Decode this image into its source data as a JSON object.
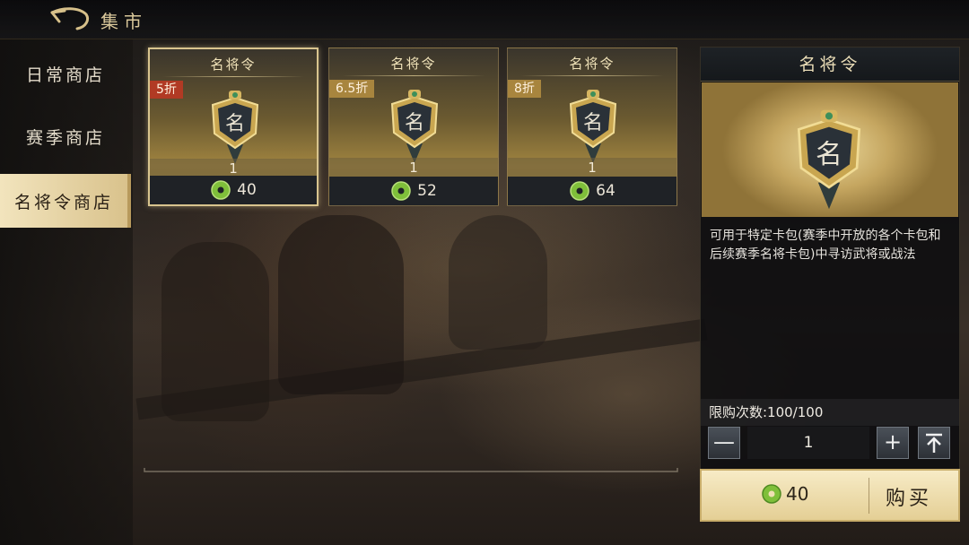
{
  "header": {
    "title": "集市"
  },
  "sidebar": {
    "items": [
      {
        "label": "日常商店"
      },
      {
        "label": "赛季商店"
      },
      {
        "label": "名将令商店",
        "active": true
      }
    ]
  },
  "shop_items": [
    {
      "name": "名将令",
      "discount": "5折",
      "quantity": "1",
      "price": "40",
      "selected": true
    },
    {
      "name": "名将令",
      "discount": "6.5折",
      "quantity": "1",
      "price": "52"
    },
    {
      "name": "名将令",
      "discount": "8折",
      "quantity": "1",
      "price": "64"
    }
  ],
  "detail": {
    "title": "名将令",
    "description": "可用于特定卡包(赛季中开放的各个卡包和后续赛季名将卡包)中寻访武将或战法",
    "limit_text": "限购次数:100/100",
    "quantity": "1",
    "minus_glyph": "—",
    "plus_glyph": "+",
    "price": "40",
    "buy_label": "购买"
  },
  "colors": {
    "gold": "#d8c48e",
    "discount_red": "#b13a24",
    "discount_gold": "#a8853e",
    "jade_coin": "#7fbf3a"
  },
  "icons": [
    "back-arrow-icon",
    "token-icon",
    "jade-coin-icon",
    "max-arrow-icon"
  ]
}
